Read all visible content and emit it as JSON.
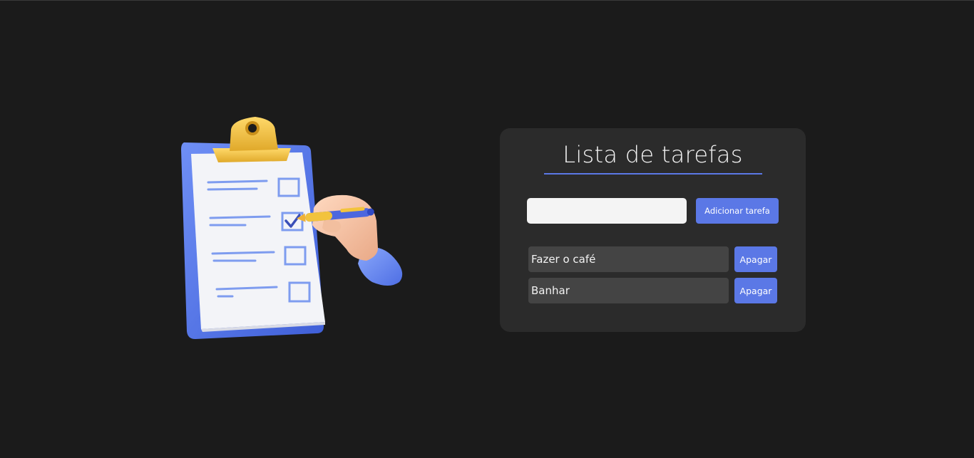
{
  "app": {
    "title": "Lista de tarefas"
  },
  "illustration": {
    "icon": "clipboard-checklist-hand-icon"
  },
  "form": {
    "input_value": "",
    "input_placeholder": "",
    "add_label": "Adicionar tarefa"
  },
  "tasks": [
    {
      "text": "Fazer o café",
      "delete_label": "Apagar"
    },
    {
      "text": "Banhar",
      "delete_label": "Apagar"
    }
  ],
  "colors": {
    "background": "#1b1b1b",
    "card": "#2b2b2b",
    "accent": "#5b78e6",
    "task_bg": "#444444",
    "input_bg": "#f4f4f4"
  }
}
